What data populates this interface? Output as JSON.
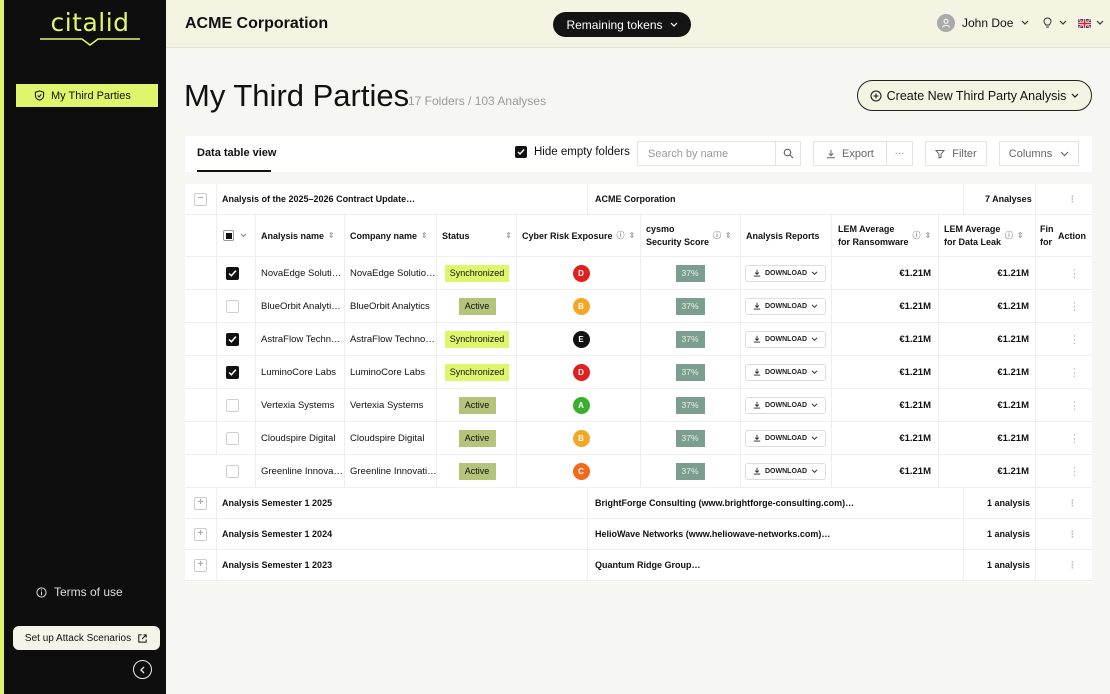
{
  "sidebar": {
    "logo": "citalid",
    "nav": [
      {
        "label": "My Third Parties",
        "icon": "shield-check-icon"
      }
    ],
    "terms_label": "Terms of use",
    "setup_label": "Set up Attack Scenarios"
  },
  "header": {
    "company": "ACME Corporation",
    "tokens_label": "Remaining tokens",
    "user_name": "John Doe"
  },
  "page": {
    "title": "My Third Parties",
    "counts": "17 Folders / 103 Analyses",
    "create_label": "Create New Third Party Analysis"
  },
  "toolbar": {
    "tab_label": "Data table view",
    "hide_empty_label": "Hide empty folders",
    "search_placeholder": "Search by name",
    "export_label": "Export",
    "more_label": "···",
    "filter_label": "Filter",
    "columns_label": "Columns"
  },
  "table": {
    "folder_top": {
      "name": "Analysis of the 2025–2026 Contract Update…",
      "company": "ACME Corporation",
      "count": "7 Analyses"
    },
    "headers": {
      "name": "Analysis name",
      "company": "Company name",
      "status": "Status",
      "risk": "Cyber Risk Exposure",
      "score_l1": "cysmo",
      "score_l2": "Security Score",
      "reports": "Analysis Reports",
      "lem_r_l1": "LEM Average",
      "lem_r_l2": "for Ransomware",
      "lem_d_l1": "LEM Average",
      "lem_d_l2": "for Data Leak",
      "fin_l1": "Fin",
      "fin_l2": "for",
      "action": "Action"
    },
    "rows": [
      {
        "checked": true,
        "name": "NovaEdge Soluti…",
        "company": "NovaEdge Solutio…",
        "status": "Synchronized",
        "grade": "D",
        "grade_color": "#e0201c",
        "score": "37%",
        "download": "DOWNLOAD",
        "lem_r": "€1.21M",
        "lem_d": "€1.21M"
      },
      {
        "checked": false,
        "name": "BlueOrbit Analyti…",
        "company": "BlueOrbit Analytics",
        "status": "Active",
        "grade": "B",
        "grade_color": "#f5a623",
        "score": "37%",
        "download": "DOWNLOAD",
        "lem_r": "€1.21M",
        "lem_d": "€1.21M"
      },
      {
        "checked": true,
        "name": "AstraFlow Techn…",
        "company": "AstraFlow Techno…",
        "status": "Synchronized",
        "grade": "E",
        "grade_color": "#111111",
        "score": "37%",
        "download": "DOWNLOAD",
        "lem_r": "€1.21M",
        "lem_d": "€1.21M"
      },
      {
        "checked": true,
        "name": "LuminoCore Labs",
        "company": "LuminoCore Labs",
        "status": "Synchronized",
        "grade": "D",
        "grade_color": "#e0201c",
        "score": "37%",
        "download": "DOWNLOAD",
        "lem_r": "€1.21M",
        "lem_d": "€1.21M"
      },
      {
        "checked": false,
        "name": "Vertexia Systems",
        "company": "Vertexia Systems",
        "status": "Active",
        "grade": "A",
        "grade_color": "#3cae2e",
        "score": "37%",
        "download": "DOWNLOAD",
        "lem_r": "€1.21M",
        "lem_d": "€1.21M"
      },
      {
        "checked": false,
        "name": "Cloudspire Digital",
        "company": "Cloudspire Digital",
        "status": "Active",
        "grade": "B",
        "grade_color": "#f5a623",
        "score": "37%",
        "download": "DOWNLOAD",
        "lem_r": "€1.21M",
        "lem_d": "€1.21M"
      },
      {
        "checked": false,
        "name": "Greenline Innova…",
        "company": "Greenline Innovati…",
        "status": "Active",
        "grade": "C",
        "grade_color": "#f26a1b",
        "score": "37%",
        "download": "DOWNLOAD",
        "lem_r": "€1.21M",
        "lem_d": "€1.21M"
      }
    ],
    "folders": [
      {
        "name": "Analysis Semester 1 2025",
        "company": "BrightForge Consulting (www.brightforge-consulting.com)…",
        "count": "1 analysis"
      },
      {
        "name": "Analysis Semester 1 2024",
        "company": "HelioWave Networks (www.heliowave-networks.com)…",
        "count": "1 analysis"
      },
      {
        "name": "Analysis Semester 1 2023",
        "company": "Quantum Ridge Group…",
        "count": "1 analysis"
      }
    ]
  },
  "colors": {
    "accent": "#dff56b",
    "sidebar_bg": "#0e0e0e",
    "score_bg": "#7b9e8f"
  }
}
